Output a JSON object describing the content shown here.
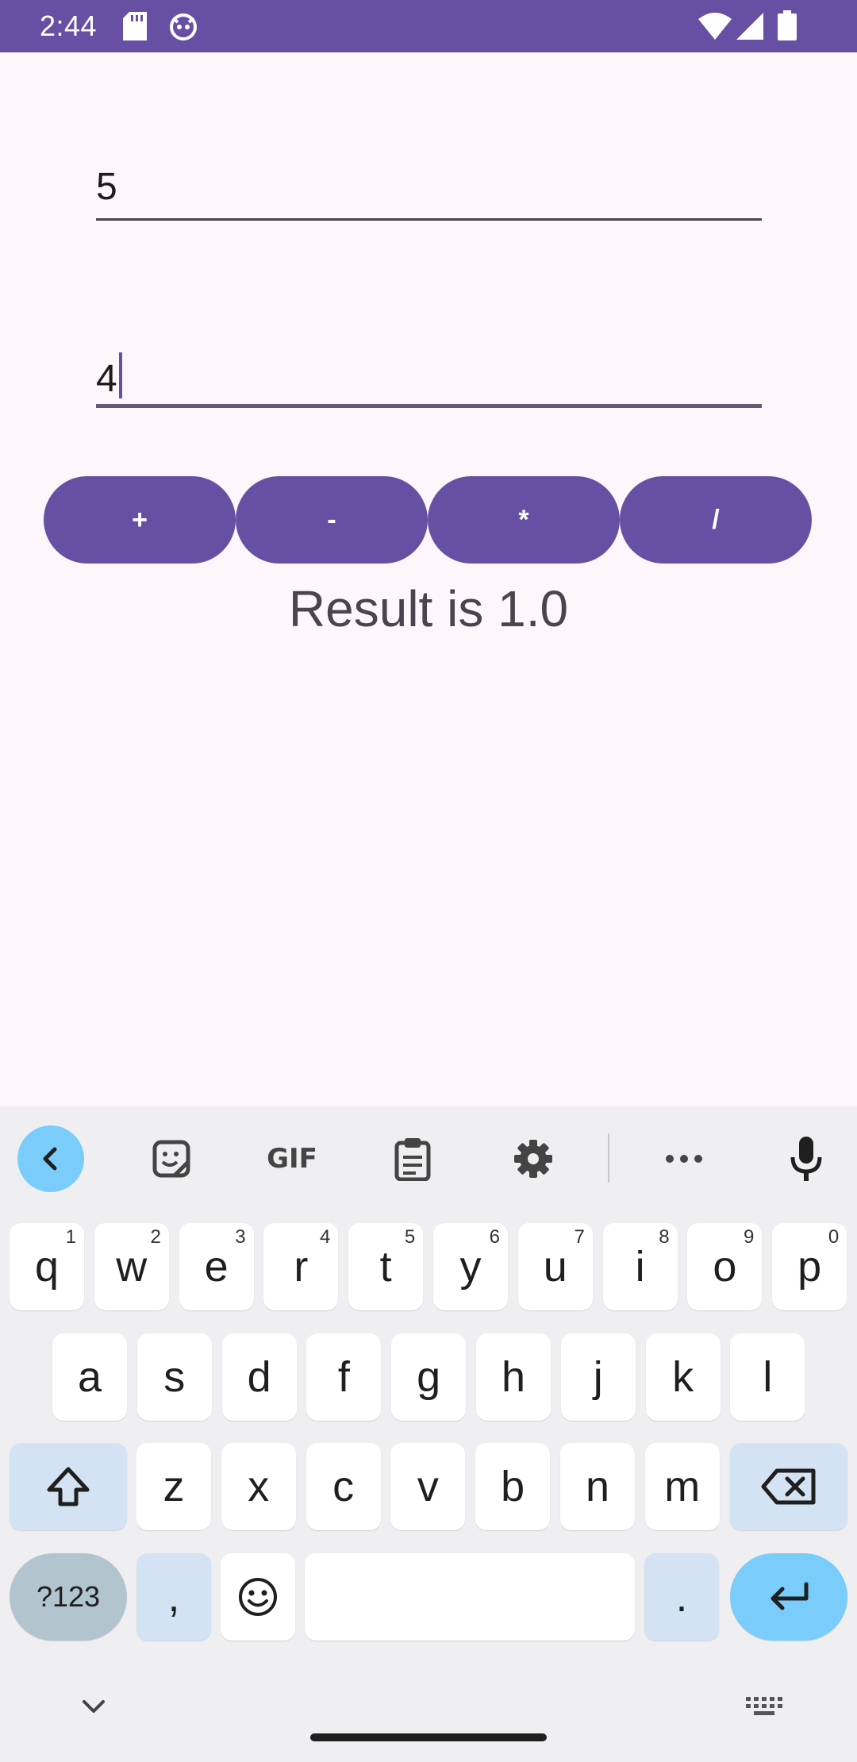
{
  "status_bar": {
    "time": "2:44"
  },
  "inputs": {
    "first_value": "5",
    "second_value": "4"
  },
  "operations": [
    {
      "label": "+"
    },
    {
      "label": "-"
    },
    {
      "label": "*"
    },
    {
      "label": "/"
    }
  ],
  "result_text": "Result is 1.0",
  "colors": {
    "primary": "#6750A4",
    "background": "#FDF7FB",
    "keyboard": "#EFEFF2",
    "accent_key": "#7ACDFB"
  },
  "keyboard": {
    "toolbar_icons": [
      "back-icon",
      "sticker-icon",
      "gif-icon",
      "clipboard-icon",
      "settings-icon",
      "more-icon",
      "mic-icon"
    ],
    "toolbar_gif_label": "GIF",
    "row1": [
      {
        "k": "q",
        "s": "1"
      },
      {
        "k": "w",
        "s": "2"
      },
      {
        "k": "e",
        "s": "3"
      },
      {
        "k": "r",
        "s": "4"
      },
      {
        "k": "t",
        "s": "5"
      },
      {
        "k": "y",
        "s": "6"
      },
      {
        "k": "u",
        "s": "7"
      },
      {
        "k": "i",
        "s": "8"
      },
      {
        "k": "o",
        "s": "9"
      },
      {
        "k": "p",
        "s": "0"
      }
    ],
    "row2": [
      "a",
      "s",
      "d",
      "f",
      "g",
      "h",
      "j",
      "k",
      "l"
    ],
    "row3": [
      "z",
      "x",
      "c",
      "v",
      "b",
      "n",
      "m"
    ],
    "symbols_label": "?123",
    "comma_label": ",",
    "period_label": "."
  }
}
